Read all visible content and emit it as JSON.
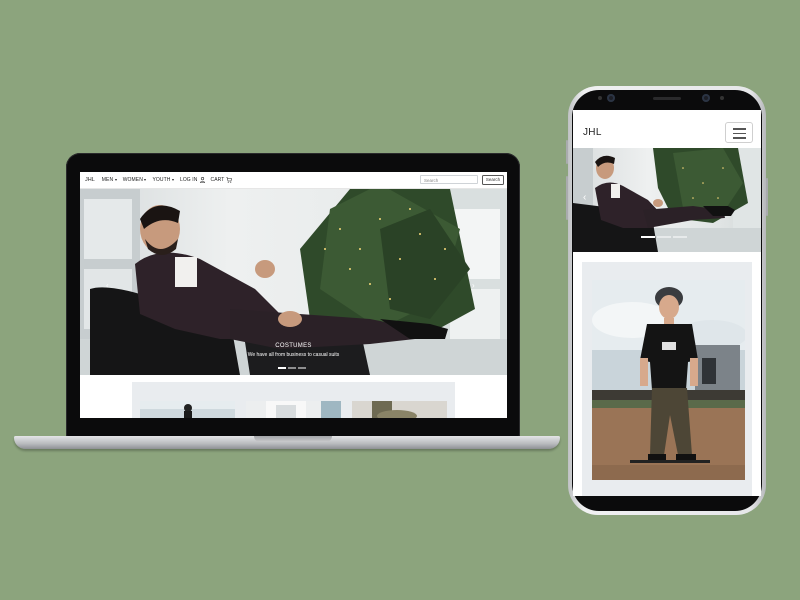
{
  "laptop": {
    "brand": "JHL",
    "menu": [
      {
        "label": "MEN",
        "dropdown": true
      },
      {
        "label": "WOMEN",
        "dropdown": true
      },
      {
        "label": "YOUTH",
        "dropdown": true
      },
      {
        "label": "LOG IN",
        "dropdown": false
      },
      {
        "label": "CART",
        "dropdown": false
      }
    ],
    "search_placeholder": "Search",
    "search_button": "Search",
    "carousel": {
      "title": "COSTUMES",
      "subtitle": "We have all from business to casual suits",
      "prev_glyph": "‹",
      "next_glyph": "›"
    }
  },
  "phone": {
    "brand": "JHL",
    "carousel": {
      "prev_glyph": "‹"
    }
  },
  "colors": {
    "background": "#8ca47d",
    "device_black": "#0b0b0c",
    "card_gray": "#e9ecef"
  },
  "icons": [
    "user-icon",
    "cart-icon",
    "menu-icon"
  ]
}
